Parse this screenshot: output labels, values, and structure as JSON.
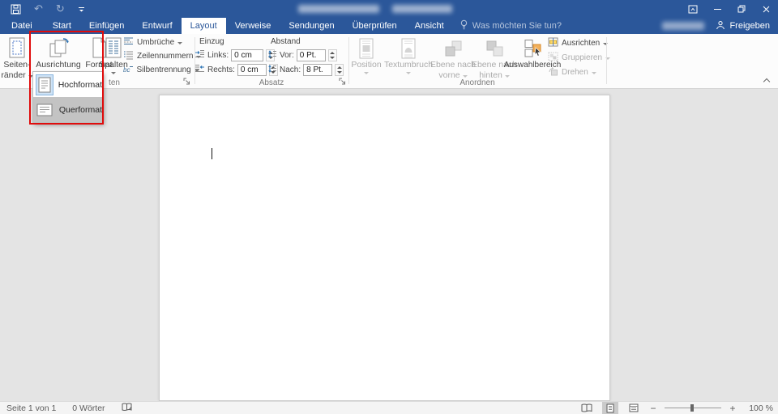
{
  "tabs": {
    "items": [
      "Datei",
      "Start",
      "Einfügen",
      "Entwurf",
      "Layout",
      "Verweise",
      "Sendungen",
      "Überprüfen",
      "Ansicht"
    ],
    "tell_me": "Was möchten Sie tun?"
  },
  "titlebar": {
    "share_label": "Freigeben"
  },
  "icons": {
    "undo_glyph": "↶",
    "redo_glyph": "↻",
    "hyphenation_glyph": "bc"
  },
  "ribbon": {
    "page_setup": {
      "margins_line1": "Seiten-",
      "margins_line2": "ränder",
      "orientation": "Ausrichtung",
      "size": "Format",
      "columns": "Spalten",
      "breaks": "Umbrüche",
      "line_numbers": "Zeilennummern",
      "hyphenation": "Silbentrennung",
      "group_label_partial": "ten"
    },
    "paragraph": {
      "group_label": "Absatz",
      "indent_header": "Einzug",
      "left_label": "Links:",
      "left_value": "0 cm",
      "right_label": "Rechts:",
      "right_value": "0 cm",
      "spacing_header": "Abstand",
      "before_label": "Vor:",
      "before_value": "0 Pt.",
      "after_label": "Nach:",
      "after_value": "8 Pt."
    },
    "arrange": {
      "group_label": "Anordnen",
      "position": "Position",
      "text_wrap": "Textumbruch",
      "forward_line1": "Ebene nach",
      "forward_line2": "vorne",
      "backward_line1": "Ebene nach",
      "backward_line2": "hinten",
      "selection_pane": "Auswahlbereich",
      "align": "Ausrichten",
      "group": "Gruppieren",
      "rotate": "Drehen"
    }
  },
  "orientation_menu": {
    "portrait": "Hochformat",
    "landscape": "Querformat"
  },
  "statusbar": {
    "page_info": "Seite 1 von 1",
    "word_count": "0 Wörter",
    "zoom_out": "−",
    "zoom_in": "+",
    "zoom_level": "100 %"
  }
}
